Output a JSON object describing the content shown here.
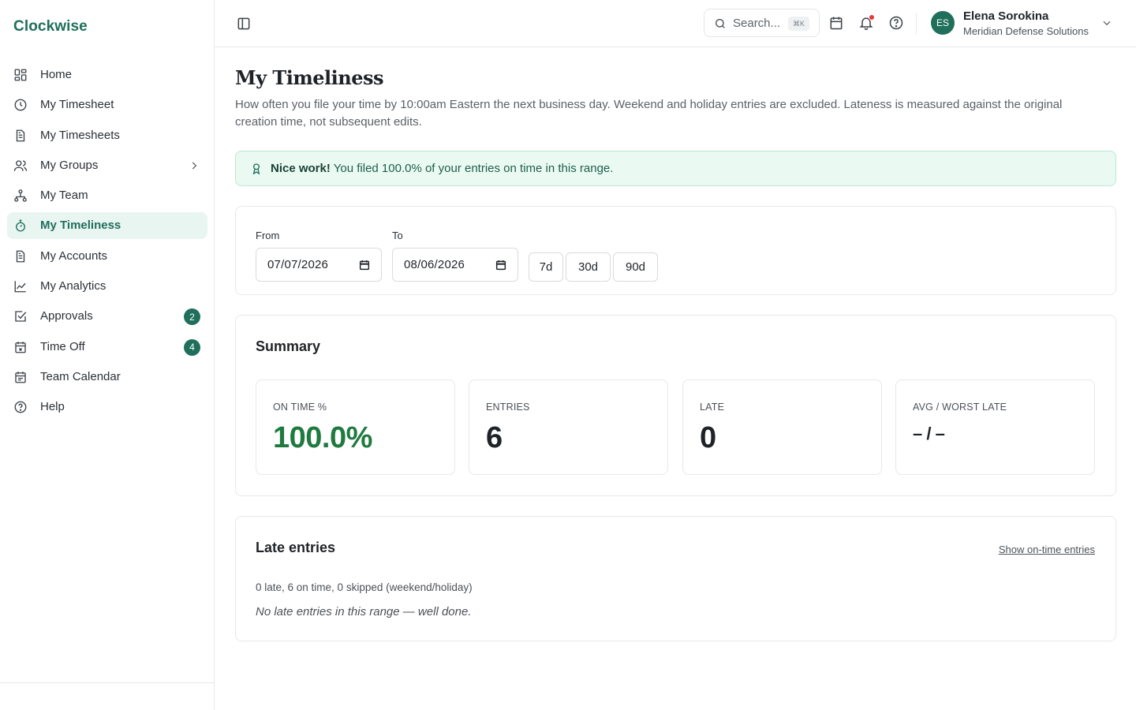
{
  "app": {
    "brand": "Clockwise",
    "accent": "#1f6f5b"
  },
  "sidebar": {
    "items": [
      {
        "label": "Home",
        "icon": "grid-icon"
      },
      {
        "label": "My Timesheet",
        "icon": "clock-icon"
      },
      {
        "label": "My Timesheets",
        "icon": "document-icon"
      },
      {
        "label": "My Groups",
        "icon": "users-icon",
        "has_submenu": true
      },
      {
        "label": "My Team",
        "icon": "org-chart-icon"
      },
      {
        "label": "My Timeliness",
        "icon": "stopwatch-icon",
        "active": true
      },
      {
        "label": "My Accounts",
        "icon": "document-icon"
      },
      {
        "label": "My Analytics",
        "icon": "line-chart-icon"
      },
      {
        "label": "Approvals",
        "icon": "check-square-icon",
        "badge": "2"
      },
      {
        "label": "Time Off",
        "icon": "calendar-icon",
        "badge": "4"
      },
      {
        "label": "Team Calendar",
        "icon": "calendar-icon"
      },
      {
        "label": "Help",
        "icon": "help-circle-icon"
      }
    ]
  },
  "topbar": {
    "search_placeholder": "Search...",
    "search_shortcut": "⌘K",
    "user": {
      "initials": "ES",
      "name": "Elena Sorokina",
      "org": "Meridian Defense Solutions"
    },
    "notification_dot_color": "#e5383b"
  },
  "page": {
    "title": "My Timeliness",
    "description": "How often you file your time by 10:00am Eastern the next business day. Weekend and holiday entries are excluded. Lateness is measured against the original creation time, not subsequent edits.",
    "banner": {
      "strong": "Nice work!",
      "text": " You filed 100.0% of your entries on time in this range."
    }
  },
  "range": {
    "from_label": "From",
    "from_value": "07/07/2026",
    "to_label": "To",
    "to_value": "08/06/2026",
    "presets": [
      "7d",
      "30d",
      "90d"
    ]
  },
  "summary": {
    "title": "Summary",
    "stats": [
      {
        "label": "ON TIME %",
        "value": "100.0%"
      },
      {
        "label": "ENTRIES",
        "value": "6"
      },
      {
        "label": "LATE",
        "value": "0"
      },
      {
        "label": "AVG / WORST LATE",
        "value": "– / –"
      }
    ]
  },
  "late_entries": {
    "title": "Late entries",
    "toggle_link": "Show on-time entries",
    "counts": "0 late, 6 on time, 0 skipped (weekend/holiday)",
    "empty_message": "No late entries in this range — well done."
  }
}
